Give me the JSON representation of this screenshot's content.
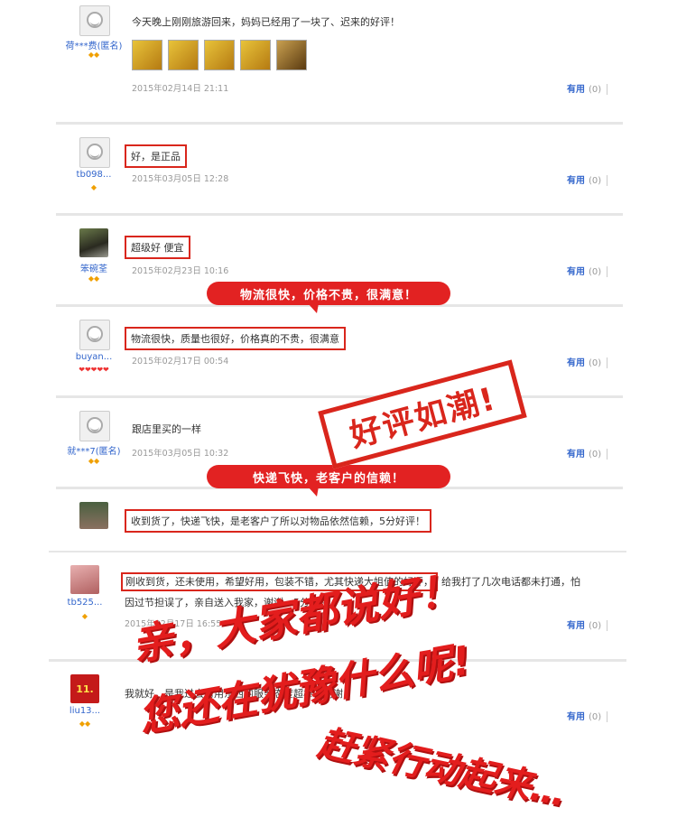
{
  "reviews": [
    {
      "user": "荷***费(匿名)",
      "rank": "◆◆",
      "comment": "今天晚上刚刚旅游回来，妈妈已经用了一块了、迟来的好评！",
      "date": "2015年02月14日 21:11",
      "useful_label": "有用",
      "useful_count": "(0)"
    },
    {
      "user": "tb098...",
      "rank": "◆",
      "comment": "好，是正品",
      "date": "2015年03月05日 12:28",
      "useful_label": "有用",
      "useful_count": "(0)"
    },
    {
      "user": "笨碗荃",
      "rank": "◆◆",
      "comment": "超级好 便宜",
      "date": "2015年02月23日 10:16",
      "useful_label": "有用",
      "useful_count": "(0)"
    },
    {
      "user": "buyan...",
      "rank": "❤❤❤❤❤",
      "comment": "物流很快，质量也很好，价格真的不贵，很满意",
      "date": "2015年02月17日 00:54",
      "useful_label": "有用",
      "useful_count": "(0)"
    },
    {
      "user": "就***7(匿名)",
      "rank": "◆◆",
      "comment": "跟店里买的一样",
      "date": "2015年03月05日 10:32",
      "useful_label": "有用",
      "useful_count": "(0)"
    },
    {
      "user": "",
      "rank": "",
      "comment": "收到货了，快递飞快，是老客户了所以对物品依然信赖，5分好评！",
      "date": "",
      "useful_label": "",
      "useful_count": ""
    },
    {
      "user": "tb525...",
      "rank": "◆",
      "comment_boxed": "刚收到货，还未使用，希望好用，包装不错，尤其快递大姐值的好评，",
      "comment_rest": "给我打了几次电话都未打通，怕",
      "comment_line2": "因过节担误了，亲自送入我家，谢谢，5分好评",
      "date": "2015年02月17日 16:55",
      "useful_label": "有用",
      "useful_count": "(0)"
    },
    {
      "user": "liu13...",
      "rank": "◆◆",
      "avatar_text": "11.",
      "comment": "我就好，是我过去常用东西的服务态度超棒，谢谢",
      "date": "",
      "useful_label": "有用",
      "useful_count": "(0)"
    }
  ],
  "bubbles": {
    "logistics": "物流很快，价格不贵，很满意！",
    "delivery": "快递飞快，老客户的信赖！"
  },
  "stamp": "好评如潮!",
  "slogans": {
    "line1": "亲，大家都说好！",
    "line2": "您还在犹豫什么呢!",
    "line3": "赶紧行动起来…"
  },
  "colors": {
    "accent_red": "#e22222",
    "link_blue": "#3366cc"
  }
}
